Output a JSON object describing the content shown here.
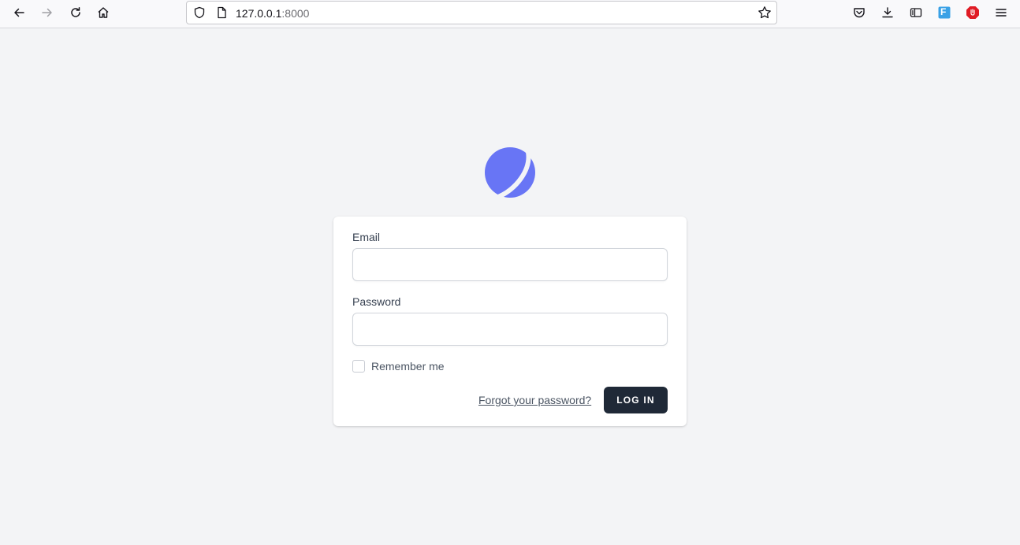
{
  "browser": {
    "url_host": "127.0.0.1",
    "url_port": ":8000",
    "icons": [
      "back-icon",
      "forward-icon",
      "reload-icon",
      "home-icon",
      "shield-icon",
      "page-icon",
      "bookmark-star-icon",
      "pocket-icon",
      "downloads-icon",
      "reader-view-icon",
      "extension-f-icon",
      "extension-red-icon",
      "menu-icon"
    ],
    "extension_letter": "F"
  },
  "logo": {
    "color": "#6875f5"
  },
  "form": {
    "email_label": "Email",
    "email_value": "",
    "password_label": "Password",
    "password_value": "",
    "remember_label": "Remember me",
    "forgot_link": "Forgot your password?",
    "login_button": "LOG IN"
  },
  "colors": {
    "background": "#f3f4f6",
    "button": "#1f2937",
    "accent": "#6875f5"
  }
}
